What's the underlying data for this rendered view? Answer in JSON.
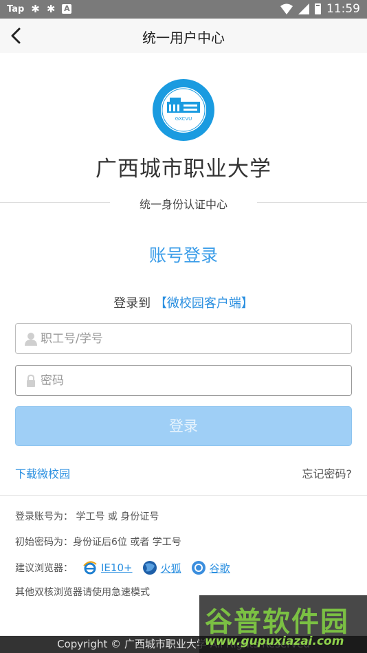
{
  "status_bar": {
    "left_label": "Tap",
    "left_icon_a": "A",
    "time": "11:59",
    "icons": [
      "sync-icon",
      "sync-icon",
      "a-icon",
      "wifi-icon",
      "signal-icon",
      "battery-icon"
    ]
  },
  "appbar": {
    "title": "统一用户中心",
    "back_icon": "chevron-left-icon"
  },
  "university": {
    "name": "广西城市职业大学",
    "logo_text": "GXCVU"
  },
  "subtitle": "统一身份认证中心",
  "login": {
    "heading": "账号登录",
    "login_to_prefix": "登录到",
    "client_name": "【微校园客户端】",
    "username_placeholder": "职工号/学号",
    "password_placeholder": "密码",
    "submit_label": "登录"
  },
  "links": {
    "download": "下载微校园",
    "forgot": "忘记密码?"
  },
  "info": {
    "account_hint": "登录账号为： 学工号 或 身份证号",
    "password_hint": "初始密码为：身份证后6位 或者 学工号",
    "browser_label": "建议浏览器：",
    "browsers": [
      {
        "name": "IE10+",
        "icon": "ie-icon"
      },
      {
        "name": "火狐",
        "icon": "firefox-icon"
      },
      {
        "name": "谷歌",
        "icon": "chrome-icon"
      }
    ],
    "dual_core_hint": "其他双核浏览器请使用急速模式"
  },
  "footer": {
    "text": "Copyright © 广西城市职业大学 All Rights Reserved"
  },
  "watermark": {
    "title": "谷普软件园",
    "url": "www.gupuxiazai.com"
  },
  "colors": {
    "accent": "#3a9ce8",
    "link": "#2a8fe0",
    "button_disabled": "#9fcff6",
    "footer_bg": "#333333"
  }
}
